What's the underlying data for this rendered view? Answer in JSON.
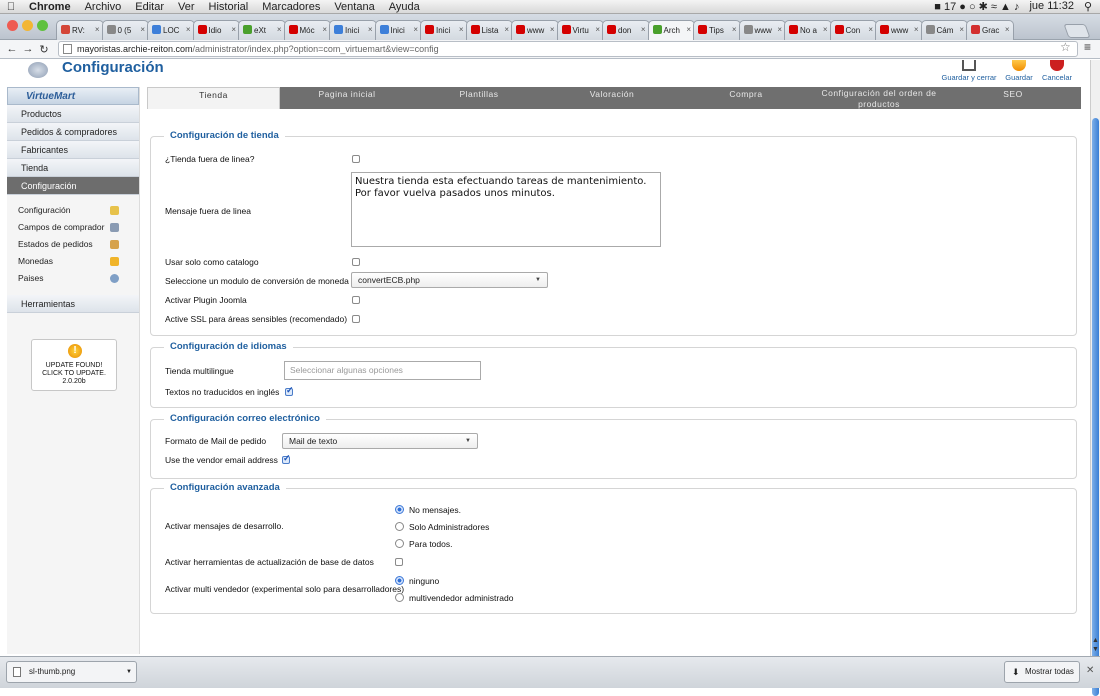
{
  "mac_menu": {
    "app": "Chrome",
    "items": [
      "Archivo",
      "Editar",
      "Ver",
      "Historial",
      "Marcadores",
      "Ventana",
      "Ayuda"
    ],
    "status_text": "17",
    "clock": "jue 11:32"
  },
  "tabs": [
    {
      "label": "RV:",
      "color": "#d44638"
    },
    {
      "label": "0 (5",
      "color": "#888"
    },
    {
      "label": "LOC",
      "color": "#3d7fd9"
    },
    {
      "label": "Idio",
      "color": "#d40000"
    },
    {
      "label": "eXt",
      "color": "#4aa02c"
    },
    {
      "label": "Móc",
      "color": "#d40000"
    },
    {
      "label": "Inici",
      "color": "#3d7fd9"
    },
    {
      "label": "Inici",
      "color": "#3d7fd9"
    },
    {
      "label": "Inici",
      "color": "#d40000"
    },
    {
      "label": "Lista",
      "color": "#d40000"
    },
    {
      "label": "www",
      "color": "#d40000"
    },
    {
      "label": "Virtu",
      "color": "#d40000"
    },
    {
      "label": "don",
      "color": "#d40000"
    },
    {
      "label": "Arch",
      "color": "#4aa02c",
      "active": true
    },
    {
      "label": "Tips",
      "color": "#d40000"
    },
    {
      "label": "www",
      "color": "#888"
    },
    {
      "label": "No a",
      "color": "#d40000"
    },
    {
      "label": "Con",
      "color": "#d40000"
    },
    {
      "label": "www",
      "color": "#d40000"
    },
    {
      "label": "Cám",
      "color": "#888"
    },
    {
      "label": "Grac",
      "color": "#d32f2f"
    }
  ],
  "url": {
    "host": "mayoristas.archie-reiton.com",
    "path": "/administrator/index.php?option=com_virtuemart&view=config"
  },
  "header": {
    "title": "Configuración",
    "buttons": {
      "save_close": "Guardar y cerrar",
      "save": "Guardar",
      "cancel": "Cancelar"
    }
  },
  "sidebar": {
    "brand": "VirtueMart",
    "items": [
      "Productos",
      "Pedidos & compradores",
      "Fabricantes",
      "Tienda",
      "Configuración"
    ],
    "subitems": [
      "Configuración",
      "Campos de comprador",
      "Estados de pedidos",
      "Monedas",
      "Paises"
    ],
    "tools": "Herramientas",
    "update": {
      "line1": "UPDATE FOUND!",
      "line2": "CLICK TO UPDATE.",
      "version": "2.0.20b"
    }
  },
  "content_tabs": [
    "Tienda",
    "Pagina inicial",
    "Plantillas",
    "Valoración",
    "Compra",
    "Configuración del orden de productos",
    "SEO"
  ],
  "store": {
    "legend": "Configuración de tienda",
    "offline_label": "¿Tienda fuera de linea?",
    "offline_msg_label": "Mensaje fuera de linea",
    "offline_msg": "Nuestra tienda esta efectuando tareas de mantenimiento. Por favor vuelva pasados unos minutos.",
    "catalog_label": "Usar solo como catalogo",
    "currency_label": "Seleccione un modulo de conversión de moneda",
    "currency_value": "convertECB.php",
    "joomla_label": "Activar Plugin Joomla",
    "ssl_label": "Active SSL para áreas sensibles (recomendado)"
  },
  "languages": {
    "legend": "Configuración de idiomas",
    "multi_label": "Tienda multilingue",
    "multi_placeholder": "Seleccionar algunas opciones",
    "untranslated_label": "Textos no traducidos en inglés"
  },
  "email": {
    "legend": "Configuración correo electrónico",
    "format_label": "Formato de Mail de pedido",
    "format_value": "Mail de texto",
    "vendor_label": "Use the vendor email address"
  },
  "advanced": {
    "legend": "Configuración avanzada",
    "dev_label": "Activar mensajes de desarrollo.",
    "dev_options": [
      "No mensajes.",
      "Solo Administradores",
      "Para todos."
    ],
    "db_label": "Activar herramientas de actualización de base de datos",
    "multivendor_label": "Activar multi vendedor (experimental solo para desarrolladores)",
    "multivendor_options": [
      "ninguno",
      "multivendedor administrado"
    ]
  },
  "download_bar": {
    "file": "sl-thumb.png",
    "show_all": "Mostrar todas"
  }
}
